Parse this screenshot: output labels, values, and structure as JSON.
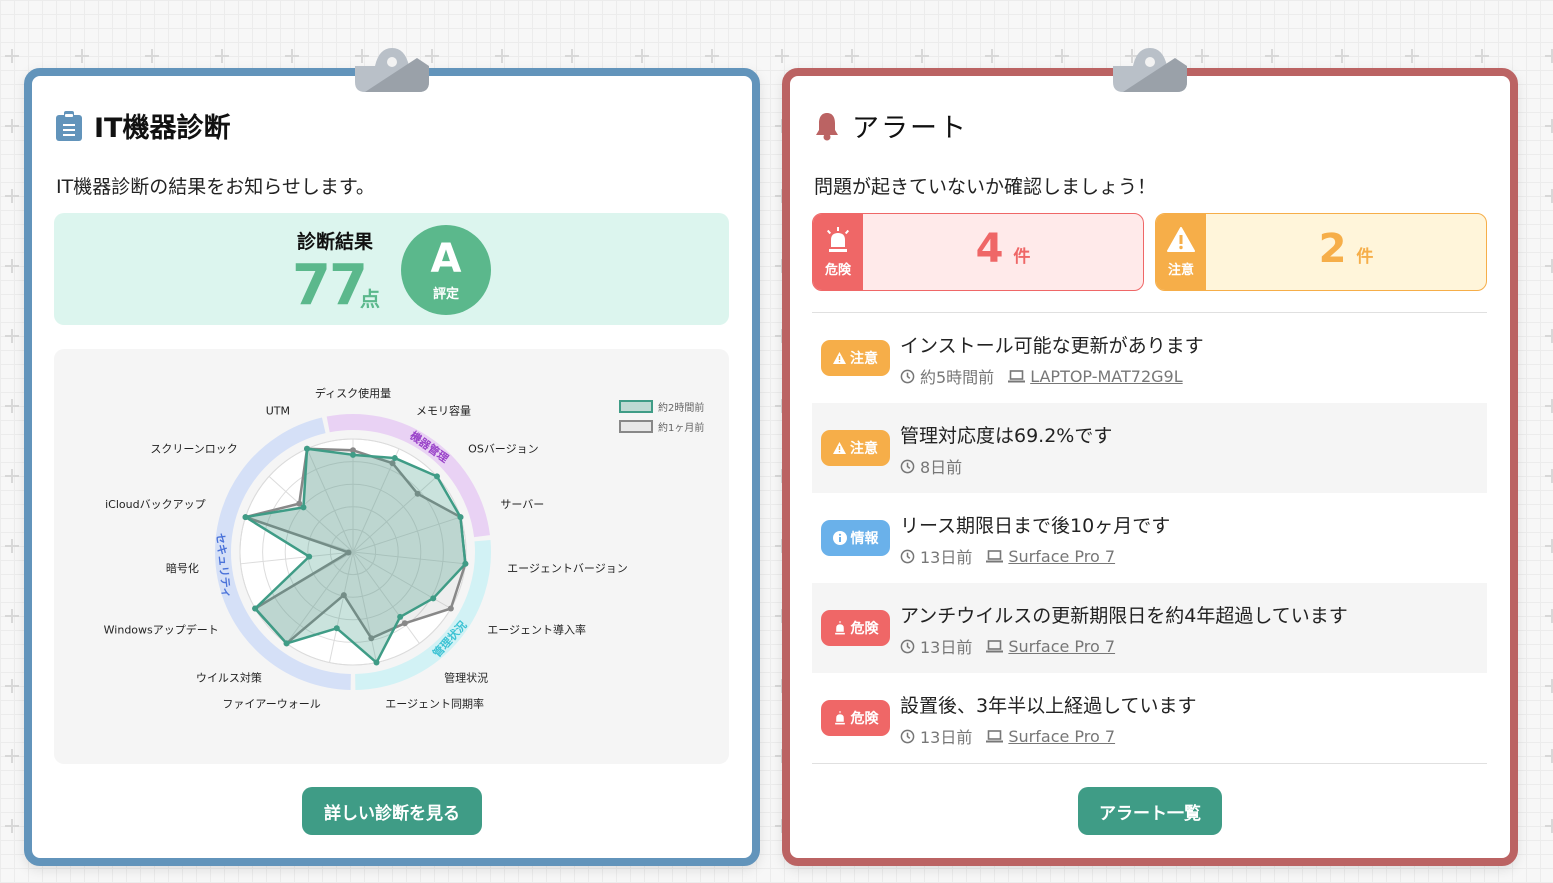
{
  "diagnosis": {
    "title": "IT機器診断",
    "description": "IT機器診断の結果をお知らせします。",
    "score_label": "診断結果",
    "score": "77",
    "score_unit": "点",
    "grade": "A",
    "grade_label": "評定",
    "button_label": "詳しい診断を見る",
    "colors": {
      "frame": "#6294bb",
      "accent": "#5bb88c",
      "button": "#3f9c86"
    }
  },
  "chart_data": {
    "type": "radar",
    "axes": [
      "ディスク使用量",
      "メモリ容量",
      "OSバージョン",
      "サーバー",
      "エージェントバージョン",
      "エージェント導入率",
      "管理状況",
      "エージェント同期率",
      "ファイアーウォール",
      "ウイルス対策",
      "Windowsアップデート",
      "暗号化",
      "iCloudバックアップ",
      "スクリーンロック",
      "UTM"
    ],
    "range": [
      0,
      100
    ],
    "grid_levels": 5,
    "series": [
      {
        "name": "約2時間前",
        "color": "#3f9c86",
        "values": [
          86,
          91,
          100,
          100,
          100,
          82,
          71,
          100,
          69,
          100,
          100,
          39,
          100,
          59,
          100
        ]
      },
      {
        "name": "約1ヶ月前",
        "color": "#888888",
        "values": [
          90,
          86,
          77,
          100,
          100,
          100,
          78,
          78,
          39,
          100,
          100,
          4,
          100,
          64,
          100
        ]
      }
    ],
    "categories": [
      {
        "name": "機器管理",
        "color": "#e9d2f4",
        "text_color": "#9a44c9"
      },
      {
        "name": "管理状況",
        "color": "#d2f2f5",
        "text_color": "#3ec3d4"
      },
      {
        "name": "セキュリティ",
        "color": "#d5e0f7",
        "text_color": "#4a72d9"
      }
    ],
    "legend_position": "top-right"
  },
  "alerts": {
    "title": "アラート",
    "description": "問題が起きていないか確認しましょう！",
    "summary": [
      {
        "type": "danger",
        "label": "危険",
        "count": "4",
        "unit": "件"
      },
      {
        "type": "warn",
        "label": "注意",
        "count": "2",
        "unit": "件"
      }
    ],
    "items": [
      {
        "level": "warn",
        "badge": "注意",
        "message": "インストール可能な更新があります",
        "time": "約5時間前",
        "device": "LAPTOP-MAT72G9L"
      },
      {
        "level": "warn",
        "badge": "注意",
        "message": "管理対応度は69.2%です",
        "time": "8日前",
        "device": null
      },
      {
        "level": "info",
        "badge": "情報",
        "message": "リース期限日まで後10ヶ月です",
        "time": "13日前",
        "device": "Surface Pro 7"
      },
      {
        "level": "danger",
        "badge": "危険",
        "message": "アンチウイルスの更新期限日を約4年超過しています",
        "time": "13日前",
        "device": "Surface Pro 7"
      },
      {
        "level": "danger",
        "badge": "危険",
        "message": "設置後、3年半以上経過しています",
        "time": "13日前",
        "device": "Surface Pro 7"
      }
    ],
    "button_label": "アラート一覧",
    "colors": {
      "frame": "#bb6363",
      "danger": "#ef6767",
      "warn": "#f6ae49",
      "info": "#6ab1ea"
    }
  }
}
